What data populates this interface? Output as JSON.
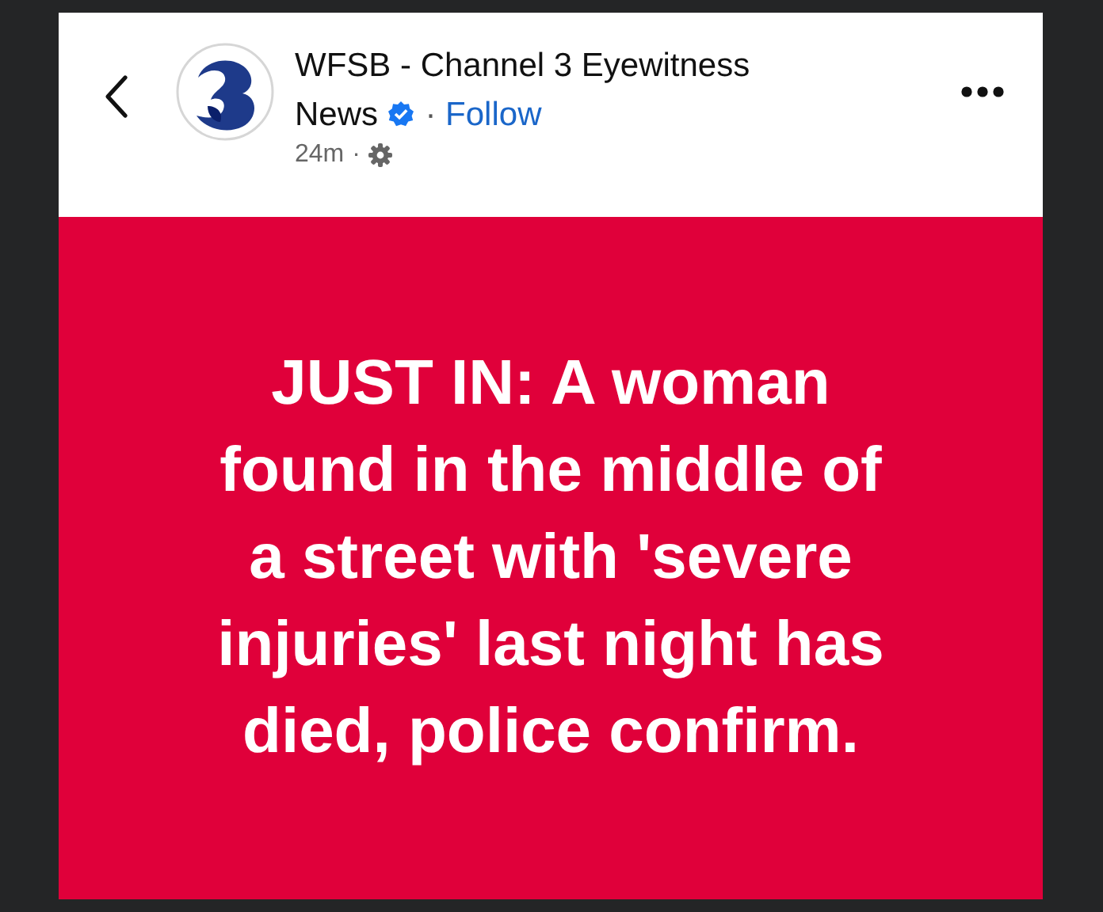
{
  "post": {
    "author": [
      "WFSB - Channel 3 Eyewitness",
      "News"
    ],
    "verified": true,
    "follow": "Follow",
    "time": "24m",
    "separator": "·"
  },
  "headline": "JUST IN: A woman\nfound in the middle of\na street with 'severe\ninjuries' last night has\ndied, police confirm."
}
